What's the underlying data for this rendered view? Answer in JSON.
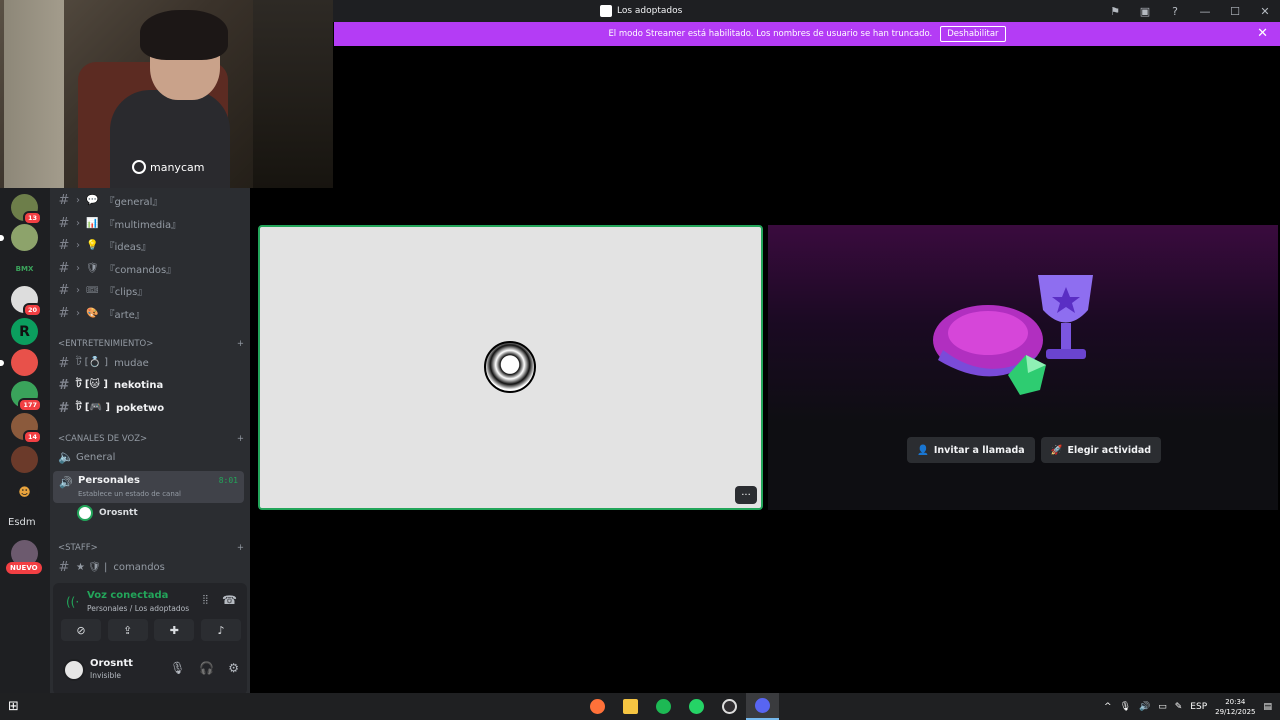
{
  "window": {
    "title": "Los adoptados"
  },
  "banner": {
    "message": "El modo Streamer está habilitado. Los nombres de usuario se han truncado.",
    "button": "Deshabilitar",
    "color": "#b43cf5"
  },
  "webcam": {
    "brand": "manycam"
  },
  "servers": {
    "badges": [
      "13",
      "20",
      "177",
      "14"
    ],
    "text_items": [
      "Esdm"
    ],
    "new_label": "NUEVO"
  },
  "channels": {
    "text": [
      {
        "name": "『general』",
        "icon": "💬"
      },
      {
        "name": "『multimedia』",
        "icon": "📊"
      },
      {
        "name": "『ideas』",
        "icon": "💡"
      },
      {
        "name": "『comandos』",
        "icon": "🛡"
      },
      {
        "name": "『clips』",
        "icon": "🎟"
      },
      {
        "name": "『arte』",
        "icon": "🎨"
      }
    ],
    "cat_entertainment": "<ENTRETENIMIENTO>",
    "entertainment": [
      {
        "name": "mudae",
        "prefix": "ট [💍 ]"
      },
      {
        "name": "nekotina",
        "prefix": "ট [🐱 ]"
      },
      {
        "name": "poketwo",
        "prefix": "ট [🎮 ]"
      }
    ],
    "cat_voice": "<CANALES DE VOZ>",
    "voice": [
      {
        "name": "General"
      },
      {
        "name": "Personales",
        "status": "Establece un estado de canal",
        "timer": "8:01"
      }
    ],
    "voice_user": "Orosntt",
    "cat_staff": "<STAFF>",
    "staff": [
      {
        "name": "comandos",
        "prefix": "★ 🛡 |"
      }
    ]
  },
  "voice_panel": {
    "title": "Voz conectada",
    "subtitle": "Personales / Los adoptados"
  },
  "user": {
    "name": "Orosntt",
    "status": "Invisible"
  },
  "activity": {
    "invite": "Invitar a llamada",
    "choose": "Elegir actividad"
  },
  "taskbar": {
    "lang": "ESP",
    "time": "20:34",
    "date": "29/12/2025"
  }
}
